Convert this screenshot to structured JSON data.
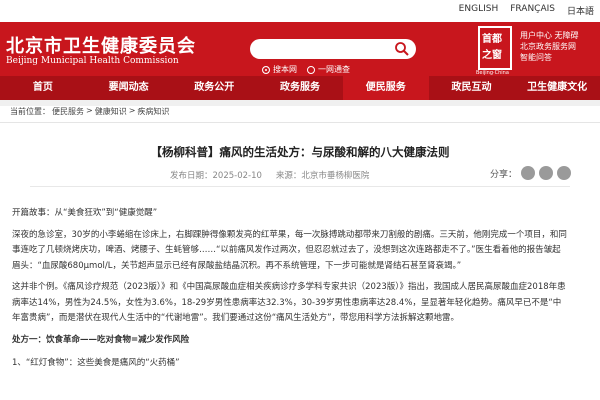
{
  "langs": [
    "ENGLISH",
    "FRANÇAIS",
    "日本語"
  ],
  "site": {
    "title_cn": "北京市卫生健康委员会",
    "title_en": "Beijing Municipal Health Commission"
  },
  "search": {
    "placeholder": "",
    "options": [
      "搜本网",
      "一网通查"
    ],
    "selected": 0
  },
  "seal": {
    "line1": "首都",
    "line2": "之窗",
    "sub": "Beijing·China"
  },
  "userlinks": [
    "用户中心 无障碍",
    "北京政务服务网",
    "智能问答"
  ],
  "nav": [
    "首页",
    "要闻动态",
    "政务公开",
    "政务服务",
    "便民服务",
    "政民互动",
    "卫生健康文化"
  ],
  "nav_active": 4,
  "breadcrumb": {
    "prefix": "当前位置：",
    "items": [
      "便民服务",
      "健康知识",
      "疾病知识"
    ],
    "sep": ">"
  },
  "article": {
    "title": "【杨柳科普】痛风的生活处方：与尿酸和解的八大健康法则",
    "date": "发布日期：2025-02-10",
    "source": "来源：北京市垂杨柳医院",
    "share_label": "分享：",
    "intro_heading": "开篇故事：从“美食狂欢”到“健康觉醒”",
    "p1": "深夜的急诊室，30岁的小李蜷缩在诊床上，右脚踝肿得像颗发亮的红苹果，每一次脉搏跳动都带来刀割般的剧痛。三天前，他刚完成一个项目，和同事连吃了几顿烧烤庆功，啤酒、烤腰子、生蚝管够……“以前痛风发作过两次，但忍忍就过去了，没想到这次连路都走不了。”医生看着他的报告皱起眉头：“血尿酸680μmol/L，关节超声显示已经有尿酸盐结晶沉积。再不系统管理，下一步可能就是肾结石甚至肾衰竭。”",
    "p2": "这并非个例。《痛风诊疗规范（2023版）》和《中国高尿酸血症相关疾病诊疗多学科专家共识（2023版）》指出，我国成人居民高尿酸血症2018年患病率达14%，男性为24.5%，女性为3.6%，18-29岁男性患病率达32.3%，30-39岁男性患病率达28.4%，呈显著年轻化趋势。痛风早已不是“中年富贵病”，而是潜伏在现代人生活中的“代谢地雷”。我们要通过这份“痛风生活处方”，带您用科学方法拆解这颗地雷。",
    "section1": "处方一：饮食革命——吃对食物=减少发作风险",
    "item1": "1、“红灯食物”：这些美食是痛风的“火药桶”"
  }
}
